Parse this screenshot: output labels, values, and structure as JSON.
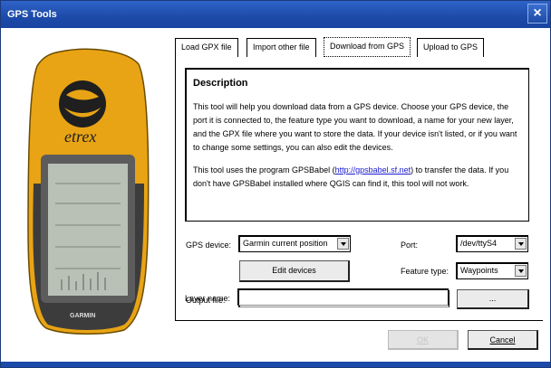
{
  "window": {
    "title": "GPS Tools",
    "close_glyph": "×"
  },
  "tabs": [
    {
      "label": "Load GPX file",
      "active": false
    },
    {
      "label": "Import other file",
      "active": false
    },
    {
      "label": "Download from GPS",
      "active": true
    },
    {
      "label": "Upload to GPS",
      "active": false
    }
  ],
  "device_image": {
    "brand": "etrex",
    "maker": "GARMIN",
    "icon": "gps-device-image"
  },
  "description": {
    "title": "Description",
    "para1": "This tool will help you download data from a GPS device. Choose your GPS device, the port it is connected to, the feature type you want to download, a name for your new layer, and the GPX file where you want to store the data. If your device isn't listed, or if you want to change some settings, you can also edit the devices.",
    "para2_before": "This tool uses the program GPSBabel (",
    "para2_link": "http://gpsbabel.sf.net",
    "para2_after": ") to transfer the data. If you don't have GPSBabel installed where QGIS can find it, this tool will not work."
  },
  "form": {
    "gps_device_label": "GPS device:",
    "gps_device_value": "Garmin current position",
    "port_label": "Port:",
    "port_value": "/dev/ttyS4",
    "edit_devices_label": "Edit devices",
    "feature_type_label": "Feature type:",
    "feature_type_value": "Waypoints",
    "output_file_label": "Output file:",
    "output_file_value": "",
    "browse_label": "...",
    "layer_name_label": "Layer name:",
    "layer_name_value": ""
  },
  "footer": {
    "ok_label": "OK",
    "cancel_label": "Cancel"
  }
}
